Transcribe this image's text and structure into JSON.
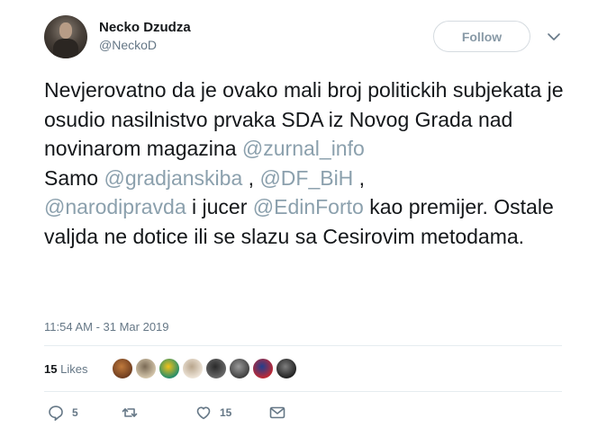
{
  "author": {
    "name": "Necko Dzudza",
    "handle": "@NeckoD"
  },
  "follow_button": {
    "label": "Follow"
  },
  "tweet": {
    "segments": [
      {
        "text": "Nevjerovatno da je ovako mali broj politickih subjekata je osudio nasilnistvo prvaka SDA iz Novog Grada nad novinarom magazina ",
        "type": "plain"
      },
      {
        "text": "@zurnal_info",
        "type": "mention"
      },
      {
        "text": "\nSamo ",
        "type": "plain"
      },
      {
        "text": "@gradjanskiba",
        "type": "mention"
      },
      {
        "text": " , ",
        "type": "plain"
      },
      {
        "text": "@DF_BiH",
        "type": "mention"
      },
      {
        "text": " ,\n",
        "type": "plain"
      },
      {
        "text": "@narodipravda",
        "type": "mention"
      },
      {
        "text": " i jucer ",
        "type": "plain"
      },
      {
        "text": "@EdinForto",
        "type": "mention"
      },
      {
        "text": " kao premijer. Ostale valjda ne dotice ili se slazu sa Cesirovim metodama.",
        "type": "plain"
      }
    ],
    "timestamp": "11:54 AM - 31 Mar 2019"
  },
  "likes": {
    "count": "15",
    "label": "Likes",
    "liker_avatars": [
      {
        "colors": [
          "#6b3a1e",
          "#c07a3c"
        ]
      },
      {
        "colors": [
          "#d9cbb0",
          "#7a6a55"
        ]
      },
      {
        "colors": [
          "#1a8a6e",
          "#f2c21a"
        ]
      },
      {
        "colors": [
          "#f1e8dc",
          "#b8a58c"
        ]
      },
      {
        "colors": [
          "#6c6c6c",
          "#2a2a2a"
        ]
      },
      {
        "colors": [
          "#3a3a3a",
          "#9a9a9a"
        ]
      },
      {
        "colors": [
          "#c7272f",
          "#1f3f8f"
        ]
      },
      {
        "colors": [
          "#1c1c1c",
          "#7e7e7e"
        ]
      }
    ]
  },
  "actions": {
    "replies": "5",
    "retweets": "",
    "likes": "15"
  },
  "colors": {
    "text": "#14171a",
    "secondary": "#657786",
    "mention": "#8ba0ad",
    "divider": "#e6ecf0"
  }
}
